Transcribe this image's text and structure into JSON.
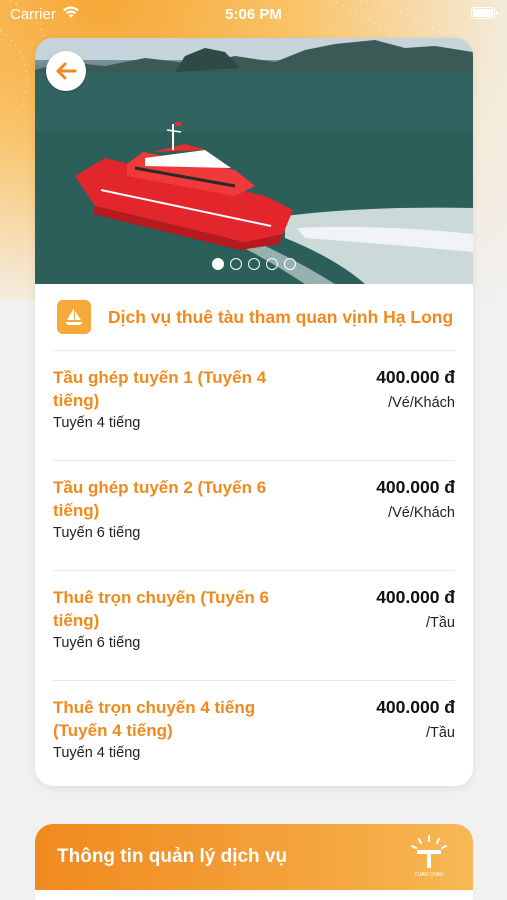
{
  "status_bar": {
    "carrier": "Carrier",
    "time": "5:06 PM"
  },
  "hero": {
    "carousel_pages": 5,
    "active_page": 0
  },
  "service": {
    "title": "Dịch vụ thuê tàu tham quan vịnh Hạ Long",
    "icon": "sailboat-icon"
  },
  "items": [
    {
      "name": "Tầu ghép tuyến 1 (Tuyến 4 tiếng)",
      "sub": "Tuyến 4 tiếng",
      "price": "400.000 đ",
      "unit": "/Vé/Khách"
    },
    {
      "name": "Tầu ghép tuyến 2 (Tuyến 6 tiếng)",
      "sub": "Tuyến 6 tiếng",
      "price": "400.000 đ",
      "unit": "/Vé/Khách"
    },
    {
      "name": "Thuê trọn chuyến (Tuyến 6 tiếng)",
      "sub": "Tuyến 6 tiếng",
      "price": "400.000 đ",
      "unit": "/Tầu"
    },
    {
      "name": "Thuê trọn chuyến 4 tiếng (Tuyến 4 tiếng)",
      "sub": "Tuyến 4 tiếng",
      "price": "400.000 đ",
      "unit": "/Tầu"
    }
  ],
  "info": {
    "title": "Thông tin quản lý dịch vụ",
    "logo_text": "TUAN CHAU"
  },
  "colors": {
    "accent": "#f08a1e",
    "accent_light": "#f6a93b"
  }
}
